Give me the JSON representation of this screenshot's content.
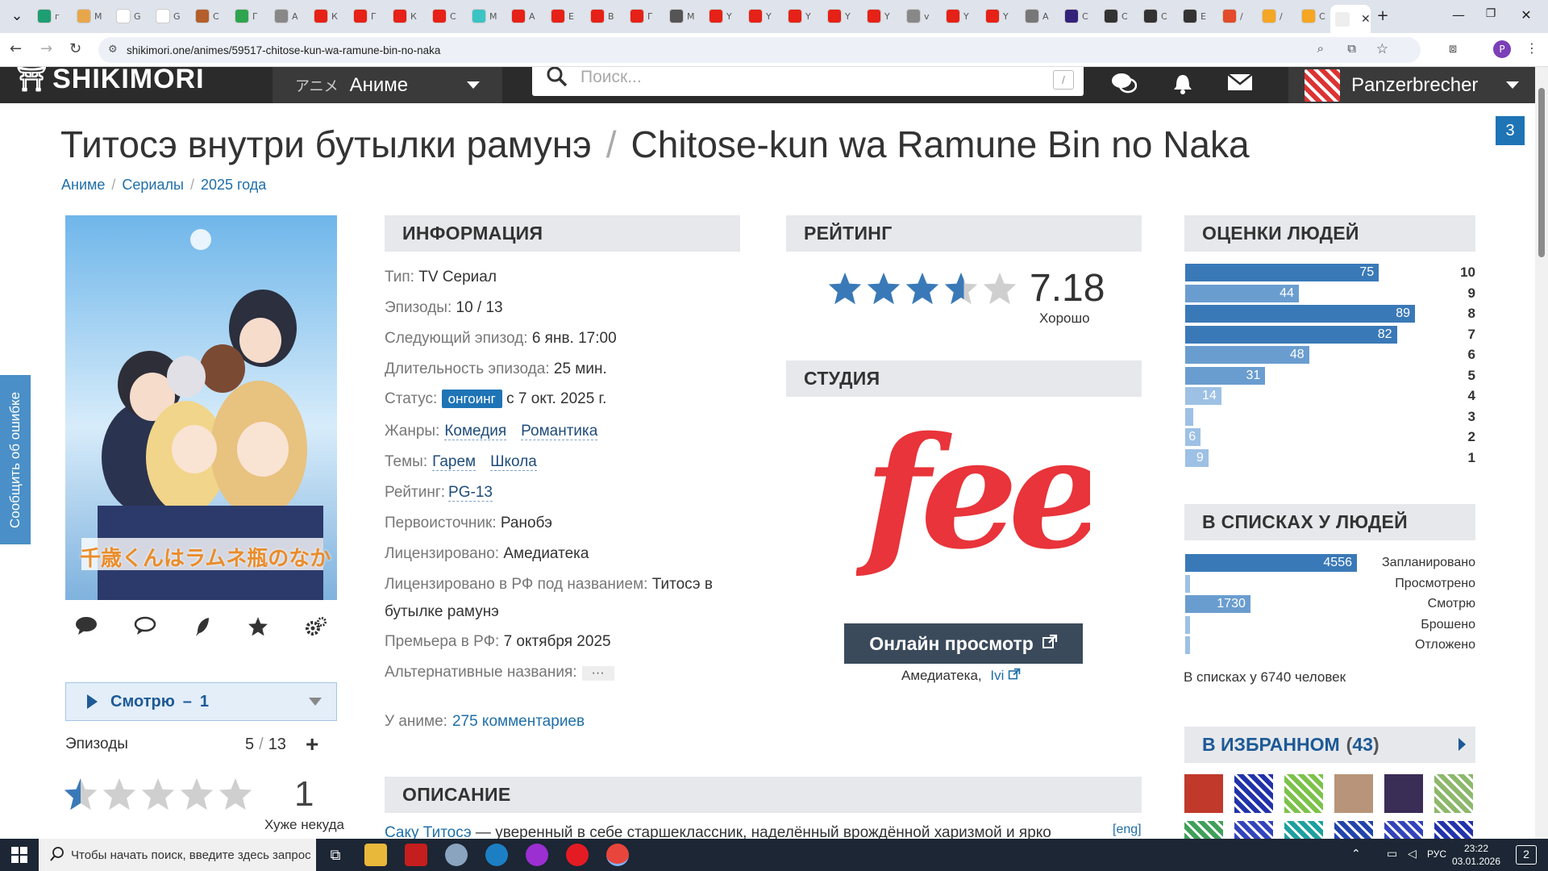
{
  "browser": {
    "tab_letters": [
      "г",
      "М",
      "G",
      "G",
      "С",
      "Г",
      "А",
      "К",
      "Г",
      "К",
      "С",
      "М",
      "А",
      "Е",
      "В",
      "Г",
      "М",
      "Y",
      "Y",
      "Y",
      "Y",
      "Y",
      "v",
      "Y",
      "Y",
      "А",
      "С",
      "С",
      "С",
      "Е",
      "/",
      "/",
      "С"
    ],
    "url": "shikimori.one/animes/59517-chitose-kun-wa-ramune-bin-no-naka",
    "profile_letter": "P"
  },
  "header": {
    "logo": "SHIKIMORI",
    "menu_jp": "アニメ",
    "menu_label": "Аниме",
    "search_placeholder": "Поиск...",
    "search_hotkey": "/",
    "username": "Panzerbrecher"
  },
  "page": {
    "title_ru": "Титосэ внутри бутылки рамунэ",
    "title_sep": "/",
    "title_en": "Chitose-kun wa Ramune Bin no Naka",
    "breadcrumb": [
      "Аниме",
      "Сериалы",
      "2025 года"
    ],
    "notif_count": "3",
    "report_tab": "Сообщить об ошибке"
  },
  "poster": {
    "logo_text": "千歳くんはラムネ瓶のなか"
  },
  "user_rate": {
    "status": "Смотрю",
    "dash": "–",
    "rewatches": "1",
    "episodes_label": "Эпизоды",
    "episodes_watched": "5",
    "episodes_sep": "/",
    "episodes_total": "13",
    "score": "1",
    "score_label": "Хуже некуда",
    "score_fraction": 0.1
  },
  "info": {
    "heading": "ИНФОРМАЦИЯ",
    "type_k": "Тип:",
    "type_v": "TV Сериал",
    "episodes_k": "Эпизоды:",
    "episodes_v": "10 / 13",
    "next_k": "Следующий эпизод:",
    "next_v": "6 янв. 17:00",
    "duration_k": "Длительность эпизода:",
    "duration_v": "25 мин.",
    "status_k": "Статус:",
    "status_pill": "онгоинг",
    "status_v": "с 7 окт. 2025 г.",
    "genres_k": "Жанры:",
    "genres": [
      "Комедия",
      "Романтика"
    ],
    "themes_k": "Темы:",
    "themes": [
      "Гарем",
      "Школа"
    ],
    "rating_k": "Рейтинг:",
    "rating_v": "PG-13",
    "source_k": "Первоисточник:",
    "source_v": "Ранобэ",
    "licensed_k": "Лицензировано:",
    "licensed_v": "Амедиатека",
    "licensed_ru_k": "Лицензировано в РФ под названием:",
    "licensed_ru_v1": "Титосэ в",
    "licensed_ru_v2": "бутылке рамунэ",
    "premiere_k": "Премьера в РФ:",
    "premiere_v": "7 октября 2025",
    "alt_k": "Альтернативные названия:",
    "alt_v": "···",
    "comments_k": "У аниме:",
    "comments_v": "275 комментариев"
  },
  "rating": {
    "heading": "РЕЙТИНГ",
    "value": "7.18",
    "label": "Хорошо",
    "stars_fraction": 0.718
  },
  "studio": {
    "heading": "СТУДИЯ",
    "logo_text": "feel",
    "watch_button": "Онлайн просмотр",
    "links": [
      "Амедиатека,",
      "Ivi"
    ]
  },
  "description": {
    "heading": "ОПИСАНИЕ",
    "link": "Саку Титосэ",
    "text": " — уверенный в себе старшеклассник, наделённый врождённой харизмой и ярко",
    "eng": "[eng]"
  },
  "scores": {
    "heading": "ОЦЕНКИ ЛЮДЕЙ",
    "rows": [
      {
        "label": "10",
        "value": 75
      },
      {
        "label": "9",
        "value": 44
      },
      {
        "label": "8",
        "value": 89
      },
      {
        "label": "7",
        "value": 82
      },
      {
        "label": "6",
        "value": 48
      },
      {
        "label": "5",
        "value": 31
      },
      {
        "label": "4",
        "value": 14
      },
      {
        "label": "3",
        "value": 3
      },
      {
        "label": "2",
        "value": 6
      },
      {
        "label": "1",
        "value": 9
      }
    ]
  },
  "lists": {
    "heading": "В СПИСКАХ У ЛЮДЕЙ",
    "rows": [
      {
        "label": "Запланировано",
        "value": 4556
      },
      {
        "label": "Просмотрено",
        "value": 50
      },
      {
        "label": "Смотрю",
        "value": 1730
      },
      {
        "label": "Брошено",
        "value": 120
      },
      {
        "label": "Отложено",
        "value": 110
      }
    ],
    "total": "В списках у 6740 человек"
  },
  "favorites": {
    "heading": "В ИЗБРАННОМ",
    "count": "43",
    "colors": [
      "#c0392b",
      "#2233aa",
      "#7cc24a",
      "#b8957a",
      "#3a2d56",
      "#8db86b",
      "#3fa05a",
      "#3344bb",
      "#1ea0a0",
      "#2244aa",
      "#3344bb",
      "#2233aa"
    ]
  },
  "taskbar": {
    "search_placeholder": "Чтобы начать поиск, введите здесь запрос",
    "lang": "РУС",
    "time": "23:22",
    "date": "03.01.2026",
    "notif": "2"
  },
  "colors": {
    "accent": "#1e74b5",
    "bar_strong": "#3a79b8",
    "bar_mid": "#6a9dcf",
    "bar_light": "#9dc1e4",
    "star_fill": "#3a79b8",
    "star_empty": "#cfcfcf",
    "studio": "#e8343a"
  }
}
